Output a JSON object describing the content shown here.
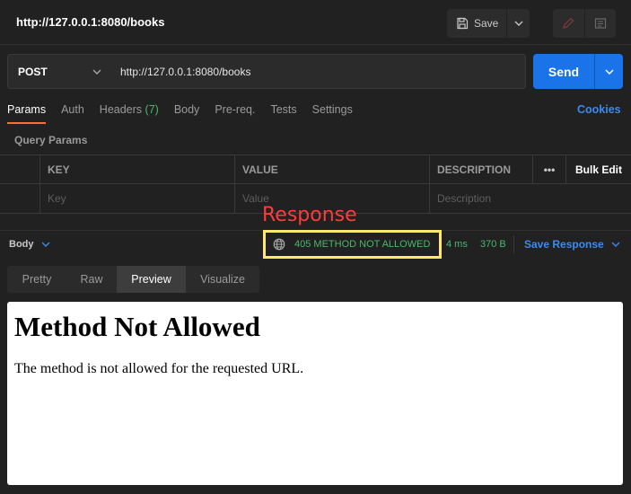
{
  "window": {
    "title": "http://127.0.0.1:8080/books"
  },
  "toolbar": {
    "save_label": "Save"
  },
  "request": {
    "method": "POST",
    "url": "http://127.0.0.1:8080/books",
    "send_label": "Send"
  },
  "tabs": [
    {
      "label": "Params",
      "active": true
    },
    {
      "label": "Auth"
    },
    {
      "label": "Headers",
      "count": "(7)"
    },
    {
      "label": "Body"
    },
    {
      "label": "Pre-req."
    },
    {
      "label": "Tests"
    },
    {
      "label": "Settings"
    }
  ],
  "cookies_label": "Cookies",
  "params": {
    "section_label": "Query Params",
    "headers": {
      "key": "KEY",
      "value": "VALUE",
      "description": "DESCRIPTION",
      "more": "•••",
      "bulk_edit": "Bulk Edit"
    },
    "placeholders": {
      "key": "Key",
      "value": "Value",
      "description": "Description"
    }
  },
  "response": {
    "annotation": "Response",
    "body_label": "Body",
    "status": "405 METHOD NOT ALLOWED",
    "time": "4 ms",
    "size": "370 B",
    "save_label": "Save Response",
    "views": [
      "Pretty",
      "Raw",
      "Preview",
      "Visualize"
    ],
    "active_view": "Preview",
    "preview": {
      "heading": "Method Not Allowed",
      "text": "The method is not allowed for the requested URL."
    }
  },
  "colors": {
    "accent_orange": "#ff6c37",
    "primary_blue": "#1a73e8",
    "status_green": "#49b86b",
    "highlight_yellow": "#ffe86b",
    "annotation_red": "#ff3b3b"
  }
}
